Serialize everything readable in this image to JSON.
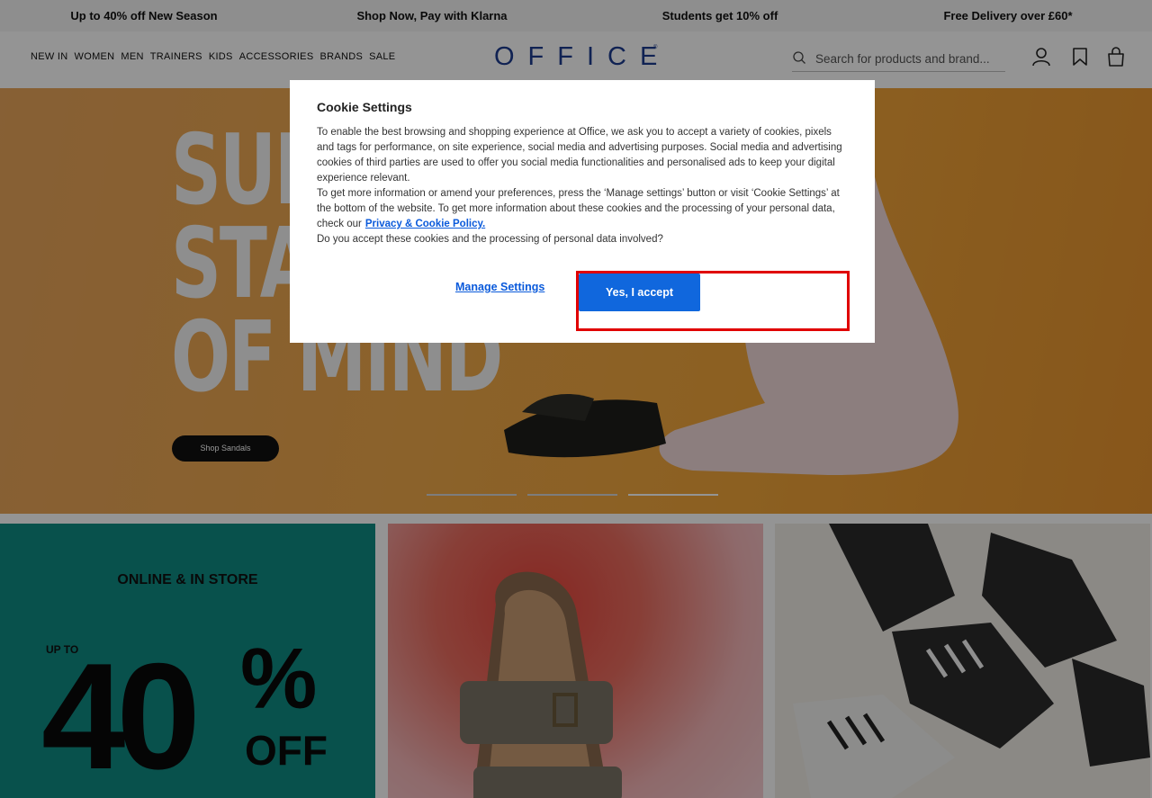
{
  "promo_bar": [
    "Up to 40% off New Season",
    "Shop Now, Pay with Klarna",
    "Students get 10% off",
    "Free Delivery over £60*"
  ],
  "nav": [
    "NEW IN",
    "WOMEN",
    "MEN",
    "TRAINERS",
    "KIDS",
    "ACCESSORIES",
    "BRANDS",
    "SALE"
  ],
  "logo": "OFFICE",
  "search": {
    "placeholder": "Search for products and brand..."
  },
  "icons": {
    "search": "search-icon",
    "account": "account-icon",
    "wishlist": "bookmark-icon",
    "bag": "bag-icon"
  },
  "hero": {
    "lines": [
      "SUN",
      "STAT",
      "OF MIND"
    ],
    "button": "Shop Sandals",
    "slides": 3,
    "active_slide": 3
  },
  "tiles": {
    "tile1": {
      "heading": "ONLINE & IN STORE",
      "upto": "UP TO",
      "value": "40",
      "percent": "%",
      "off": "OFF"
    }
  },
  "cookie_modal": {
    "title": "Cookie Settings",
    "paragraph1": "To enable the best browsing and shopping experience at Office, we ask you to accept a variety of cookies, pixels and tags for performance, on site experience, social media and advertising purposes. Social media and advertising cookies of third parties are used to offer you social media functionalities and personalised ads to keep your digital experience relevant.",
    "paragraph2": "To get more information or amend your preferences, press the ‘Manage settings’ button or visit ‘Cookie Settings’ at the bottom of the website. To get more information about these cookies and the processing of your personal data, check our",
    "link": "Privacy & Cookie Policy.",
    "paragraph3": "Do you accept these cookies and the processing of personal data involved?",
    "manage_button": "Manage Settings",
    "accept_button": "Yes, I accept"
  },
  "colors": {
    "brand": "#1d3c8f",
    "accept_button": "#1067dd",
    "link": "#0a5adb",
    "highlight": "#e00000"
  }
}
